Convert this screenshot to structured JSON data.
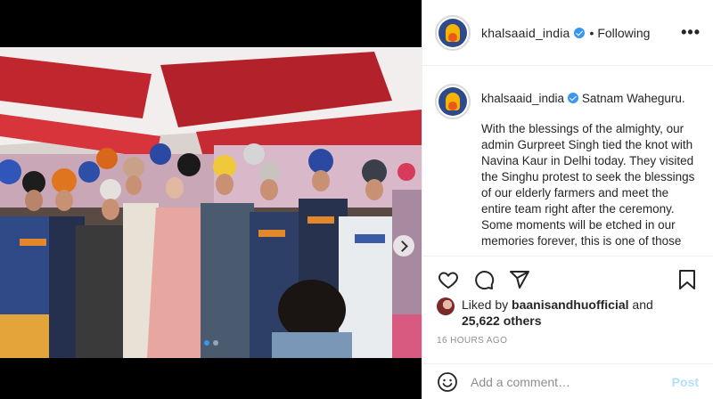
{
  "post": {
    "username": "khalsaaid_india",
    "verified": true,
    "follow_status": "• Following",
    "more_label": "•••"
  },
  "caption": {
    "username": "khalsaaid_india",
    "first_line": "Satnam Waheguru.",
    "body": "With the blessings of the almighty, our admin Gurpreet Singh tied the knot with Navina Kaur in Delhi today. They visited the Singhu protest to seek the blessings of our elderly farmers and meet the entire team right after the ceremony.\nSome moments will be etched in our memories forever, this is one of those"
  },
  "likes": {
    "prefix": "Liked by ",
    "user": "baanisandhuofficial",
    "and": " and",
    "others": "25,622 others"
  },
  "timestamp": "16 HOURS AGO",
  "comment": {
    "placeholder": "Add a comment…",
    "post_label": "Post"
  },
  "carousel": {
    "dot_count": 2,
    "active_index": 0
  },
  "colors": {
    "accent": "#3897f0",
    "post_disabled": "#b2dffc",
    "muted": "#8e8e8e",
    "tent_red": "#b8232a"
  },
  "icons": [
    "heart-icon",
    "comment-icon",
    "share-icon",
    "bookmark-icon",
    "emoji-icon",
    "verified-icon",
    "more-icon",
    "next-arrow-icon"
  ]
}
